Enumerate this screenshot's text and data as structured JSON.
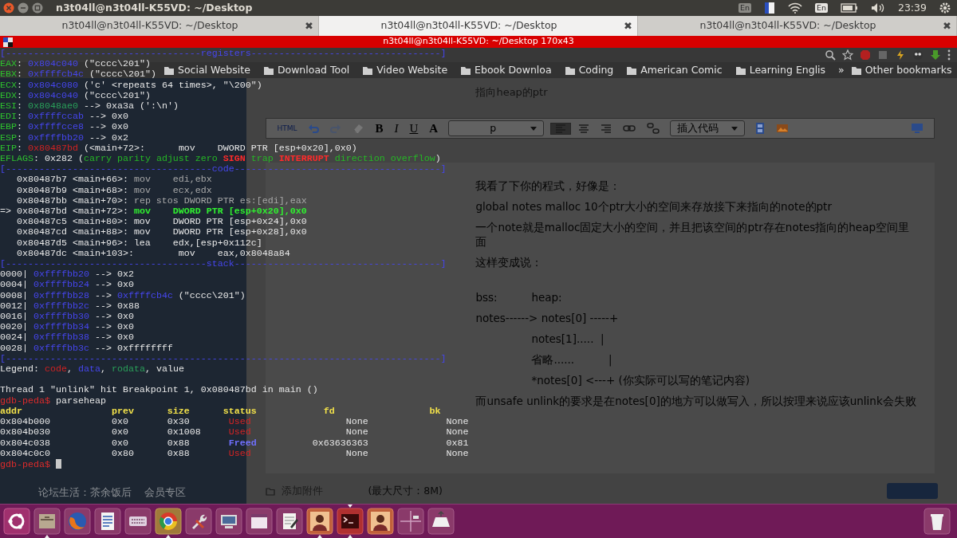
{
  "top_panel": {
    "title": "n3t04ll@n3t04ll-K55VD: ~/Desktop",
    "indicators": [
      {
        "kind": "layout-dim",
        "text": "En"
      },
      {
        "kind": "flag"
      },
      {
        "kind": "wifi"
      },
      {
        "kind": "layout",
        "text": "En"
      },
      {
        "kind": "battery"
      },
      {
        "kind": "volume"
      },
      {
        "kind": "clock",
        "text": "23:39"
      },
      {
        "kind": "gear"
      }
    ]
  },
  "terminal": {
    "tabs": [
      {
        "title": "n3t04ll@n3t04ll-K55VD: ~/Desktop",
        "selected": false,
        "close": "✖"
      },
      {
        "title": "n3t04ll@n3t04ll-K55VD: ~/Desktop",
        "selected": true,
        "close": "✖"
      },
      {
        "title": "n3t04ll@n3t04ll-K55VD: ~/Desktop",
        "selected": false,
        "close": "✖"
      }
    ],
    "title": "n3t04ll@n3t04ll-K55VD: ~/Desktop 170x43",
    "lines": [
      {
        "segments": [
          {
            "text": "[-----------------------------------registers----------------------------------]",
            "kind": "rule"
          }
        ]
      },
      {
        "segments": [
          {
            "text": "EAX",
            "kind": "reg"
          },
          {
            "text": ": ",
            "kind": "plain"
          },
          {
            "text": "0x804c040",
            "kind": "addr"
          },
          {
            "text": " (\"cccc\\201\")",
            "kind": "plain"
          }
        ]
      },
      {
        "segments": [
          {
            "text": "EBX",
            "kind": "reg"
          },
          {
            "text": ": ",
            "kind": "plain"
          },
          {
            "text": "0xffffcb4c",
            "kind": "addr"
          },
          {
            "text": " (\"cccc\\201\")",
            "kind": "plain"
          }
        ]
      },
      {
        "segments": [
          {
            "text": "ECX",
            "kind": "reg"
          },
          {
            "text": ": ",
            "kind": "plain"
          },
          {
            "text": "0x804c080",
            "kind": "addr"
          },
          {
            "text": " ('c' <repeats 64 times>, \"\\200\")",
            "kind": "plain"
          }
        ]
      },
      {
        "segments": [
          {
            "text": "EDX",
            "kind": "reg"
          },
          {
            "text": ": ",
            "kind": "plain"
          },
          {
            "text": "0x804c040",
            "kind": "addr"
          },
          {
            "text": " (\"cccc\\201\")",
            "kind": "plain"
          }
        ]
      },
      {
        "segments": [
          {
            "text": "ESI",
            "kind": "reg"
          },
          {
            "text": ": ",
            "kind": "plain"
          },
          {
            "text": "0x8048ae0",
            "kind": "rodata"
          },
          {
            "text": " --> 0xa3a (':\\n')",
            "kind": "plain"
          }
        ]
      },
      {
        "segments": [
          {
            "text": "EDI",
            "kind": "reg"
          },
          {
            "text": ": ",
            "kind": "plain"
          },
          {
            "text": "0xffffccab",
            "kind": "addr"
          },
          {
            "text": " --> 0x0",
            "kind": "plain"
          }
        ]
      },
      {
        "segments": [
          {
            "text": "EBP",
            "kind": "reg"
          },
          {
            "text": ": ",
            "kind": "plain"
          },
          {
            "text": "0xffffcce8",
            "kind": "addr"
          },
          {
            "text": " --> 0x0",
            "kind": "plain"
          }
        ]
      },
      {
        "segments": [
          {
            "text": "ESP",
            "kind": "reg"
          },
          {
            "text": ": ",
            "kind": "plain"
          },
          {
            "text": "0xffffbb20",
            "kind": "addr"
          },
          {
            "text": " --> 0x2",
            "kind": "plain"
          }
        ]
      },
      {
        "segments": [
          {
            "text": "EIP",
            "kind": "reg"
          },
          {
            "text": ": ",
            "kind": "plain"
          },
          {
            "text": "0x80487bd",
            "kind": "code"
          },
          {
            "text": " (<main+72>:      mov    DWORD PTR [esp+0x20],0x0)",
            "kind": "plain"
          }
        ]
      },
      {
        "segments": [
          {
            "text": "EFLAGS",
            "kind": "reg"
          },
          {
            "text": ": 0x282 (",
            "kind": "plain"
          },
          {
            "text": "carry parity adjust zero ",
            "kind": "flagoff"
          },
          {
            "text": "SIGN",
            "kind": "flagon"
          },
          {
            "text": " trap ",
            "kind": "flagoff"
          },
          {
            "text": "INTERRUPT",
            "kind": "flagon"
          },
          {
            "text": " direction overflow",
            "kind": "flagoff"
          },
          {
            "text": ")",
            "kind": "plain"
          }
        ]
      },
      {
        "segments": [
          {
            "text": "[-------------------------------------code-------------------------------------]",
            "kind": "rule"
          }
        ]
      },
      {
        "segments": [
          {
            "text": "   0x80487b7 <main+66>: ",
            "kind": "plain"
          },
          {
            "text": "mov    edi,ebx",
            "kind": "dim"
          }
        ]
      },
      {
        "segments": [
          {
            "text": "   0x80487b9 <main+68>: ",
            "kind": "plain"
          },
          {
            "text": "mov    ecx,edx",
            "kind": "dim"
          }
        ]
      },
      {
        "segments": [
          {
            "text": "   0x80487bb <main+70>: ",
            "kind": "plain"
          },
          {
            "text": "rep stos DWORD PTR es:[edi],eax",
            "kind": "dim"
          }
        ]
      },
      {
        "segments": [
          {
            "text": "=> 0x80487bd <main+72>: ",
            "kind": "plain"
          },
          {
            "text": "mov    DWORD PTR [esp+0x20],0x0",
            "kind": "hl"
          }
        ]
      },
      {
        "segments": [
          {
            "text": "   0x80487c5 <main+80>: mov    DWORD PTR [esp+0x24],0x0",
            "kind": "plain"
          }
        ]
      },
      {
        "segments": [
          {
            "text": "   0x80487cd <main+88>: mov    DWORD PTR [esp+0x28],0x0",
            "kind": "plain"
          }
        ]
      },
      {
        "segments": [
          {
            "text": "   0x80487d5 <main+96>: lea    edx,[esp+0x112c]",
            "kind": "plain"
          }
        ]
      },
      {
        "segments": [
          {
            "text": "   0x80487dc <main+103>:        mov    eax,0x8048a84",
            "kind": "plain"
          }
        ]
      },
      {
        "segments": [
          {
            "text": "[------------------------------------stack-------------------------------------]",
            "kind": "rule"
          }
        ]
      },
      {
        "segments": [
          {
            "text": "0000| ",
            "kind": "plain"
          },
          {
            "text": "0xffffbb20",
            "kind": "addr"
          },
          {
            "text": " --> 0x2",
            "kind": "plain"
          }
        ]
      },
      {
        "segments": [
          {
            "text": "0004| ",
            "kind": "plain"
          },
          {
            "text": "0xffffbb24",
            "kind": "addr"
          },
          {
            "text": " --> 0x0",
            "kind": "plain"
          }
        ]
      },
      {
        "segments": [
          {
            "text": "0008| ",
            "kind": "plain"
          },
          {
            "text": "0xffffbb28",
            "kind": "addr"
          },
          {
            "text": " --> ",
            "kind": "plain"
          },
          {
            "text": "0xffffcb4c",
            "kind": "addr"
          },
          {
            "text": " (\"cccc\\201\")",
            "kind": "plain"
          }
        ]
      },
      {
        "segments": [
          {
            "text": "0012| ",
            "kind": "plain"
          },
          {
            "text": "0xffffbb2c",
            "kind": "addr"
          },
          {
            "text": " --> 0x88",
            "kind": "plain"
          }
        ]
      },
      {
        "segments": [
          {
            "text": "0016| ",
            "kind": "plain"
          },
          {
            "text": "0xffffbb30",
            "kind": "addr"
          },
          {
            "text": " --> 0x0",
            "kind": "plain"
          }
        ]
      },
      {
        "segments": [
          {
            "text": "0020| ",
            "kind": "plain"
          },
          {
            "text": "0xffffbb34",
            "kind": "addr"
          },
          {
            "text": " --> 0x0",
            "kind": "plain"
          }
        ]
      },
      {
        "segments": [
          {
            "text": "0024| ",
            "kind": "plain"
          },
          {
            "text": "0xffffbb38",
            "kind": "addr"
          },
          {
            "text": " --> 0x0",
            "kind": "plain"
          }
        ]
      },
      {
        "segments": [
          {
            "text": "0028| ",
            "kind": "plain"
          },
          {
            "text": "0xffffbb3c",
            "kind": "addr"
          },
          {
            "text": " --> 0xffffffff",
            "kind": "plain"
          }
        ]
      },
      {
        "segments": [
          {
            "text": "[------------------------------------------------------------------------------]",
            "kind": "rule"
          }
        ]
      },
      {
        "segments": [
          {
            "text": "Legend: ",
            "kind": "plain"
          },
          {
            "text": "code",
            "kind": "code"
          },
          {
            "text": ", ",
            "kind": "plain"
          },
          {
            "text": "data",
            "kind": "addr"
          },
          {
            "text": ", ",
            "kind": "plain"
          },
          {
            "text": "rodata",
            "kind": "rodata"
          },
          {
            "text": ", value",
            "kind": "plain"
          }
        ]
      },
      {
        "gap_before": true,
        "segments": [
          {
            "text": "Thread 1 \"unlink\" hit Breakpoint 1, 0x080487bd in main ()",
            "kind": "plain"
          }
        ]
      },
      {
        "segments": [
          {
            "text": "gdb-peda$ ",
            "kind": "prompt"
          },
          {
            "text": "parseheap",
            "kind": "plain"
          }
        ]
      },
      {
        "segments": [
          {
            "text": "addr                prev      size      status            fd                 bk",
            "kind": "head"
          }
        ]
      },
      {
        "segments": [
          {
            "text": "0x804b000           0x0       0x30       ",
            "kind": "plain"
          },
          {
            "text": "Used",
            "kind": "used"
          },
          {
            "text": "                 None              None",
            "kind": "plain"
          }
        ]
      },
      {
        "segments": [
          {
            "text": "0x804b030           0x0       0x1008     ",
            "kind": "plain"
          },
          {
            "text": "Used",
            "kind": "used"
          },
          {
            "text": "                 None              None",
            "kind": "plain"
          }
        ]
      },
      {
        "segments": [
          {
            "text": "0x804c038           0x0       0x88       ",
            "kind": "plain"
          },
          {
            "text": "Freed",
            "kind": "freed"
          },
          {
            "text": "          0x63636363              0x81",
            "kind": "plain"
          }
        ]
      },
      {
        "segments": [
          {
            "text": "0x804c0c0           0x80      0x88       ",
            "kind": "plain"
          },
          {
            "text": "Used",
            "kind": "used"
          },
          {
            "text": "                 None              None",
            "kind": "plain"
          }
        ]
      },
      {
        "segments": [
          {
            "text": "gdb-peda$ ",
            "kind": "prompt"
          },
          {
            "kind": "cursor"
          }
        ]
      }
    ]
  },
  "browser": {
    "bookmarks": {
      "folders": [
        "Social Website",
        "Download Tool",
        "Video Website",
        "Ebook Downloa",
        "Coding",
        "American Comic",
        "Learning Englis"
      ],
      "overflow": "»",
      "other": "Other bookmarks"
    },
    "sidebar": {
      "items": [
        "论坛生活：茶余饭后",
        "会员专区"
      ]
    },
    "editor": {
      "intro": "指向heap的ptr",
      "toolbar": {
        "buttons": [
          {
            "kind": "html",
            "text": "HTML",
            "disabled": false
          },
          {
            "kind": "undo",
            "disabled": false
          },
          {
            "kind": "redo",
            "disabled": true
          },
          {
            "kind": "eraser",
            "disabled": false
          },
          {
            "kind": "bold",
            "text": "B",
            "disabled": false
          },
          {
            "kind": "italic",
            "text": "I",
            "disabled": false
          },
          {
            "kind": "underline",
            "text": "U",
            "disabled": false
          },
          {
            "kind": "color",
            "text": "A",
            "disabled": false
          }
        ],
        "format": "p",
        "alignment": [
          {
            "selected": true
          },
          {
            "selected": false
          },
          {
            "selected": false
          }
        ],
        "insert": "插入代码"
      },
      "body": [
        {
          "kind": "para",
          "text": "我看了下你的程式，好像是："
        },
        {
          "kind": "para",
          "text": "global notes malloc 10个ptr大小的空间来存放接下来指向的note的ptr"
        },
        {
          "kind": "para",
          "text": "一个note就是malloc固定大小的空间，并且把该空间的ptr存在notes指向的heap空间里面"
        },
        {
          "kind": "para",
          "text": "这样变成说："
        },
        {
          "kind": "pair",
          "text": "bss:",
          "text2": "heap:"
        },
        {
          "kind": "para",
          "text": "notes------> notes[0] -----+"
        },
        {
          "kind": "indent",
          "text": "notes[1].....  |"
        },
        {
          "kind": "indent",
          "text": "省略......          |"
        },
        {
          "kind": "indent",
          "text": "*notes[0] <---+ (你实际可以写的笔记内容)"
        },
        {
          "kind": "para",
          "text": "而unsafe unlink的要求是在notes[0]的地方可以做写入，所以按理来说应该unlink会失败"
        }
      ]
    },
    "attachment": {
      "label": "添加附件",
      "limit": "(最大尺寸：8M)"
    }
  },
  "dock": {
    "items": [
      {
        "kind": "ubuntu",
        "running": false,
        "focused": false
      },
      {
        "kind": "files",
        "running": true,
        "focused": false
      },
      {
        "kind": "fox",
        "running": false,
        "focused": false
      },
      {
        "kind": "document",
        "running": false,
        "focused": false
      },
      {
        "kind": "keyboard",
        "running": false,
        "focused": false
      },
      {
        "kind": "round",
        "running": true,
        "focused": false
      },
      {
        "kind": "tools",
        "running": false,
        "focused": false
      },
      {
        "kind": "monitor",
        "running": false,
        "focused": false
      },
      {
        "kind": "window",
        "running": false,
        "focused": false
      },
      {
        "kind": "notepad",
        "running": false,
        "focused": false
      },
      {
        "kind": "portrait",
        "running": true,
        "focused": false
      },
      {
        "kind": "terminal",
        "running": true,
        "focused": true
      },
      {
        "kind": "portrait",
        "running": false,
        "focused": false
      },
      {
        "kind": "workspaces",
        "running": false,
        "focused": false
      },
      {
        "kind": "usb",
        "running": false,
        "focused": false
      }
    ],
    "trash": {
      "kind": "trash",
      "running": false,
      "focused": false
    }
  }
}
